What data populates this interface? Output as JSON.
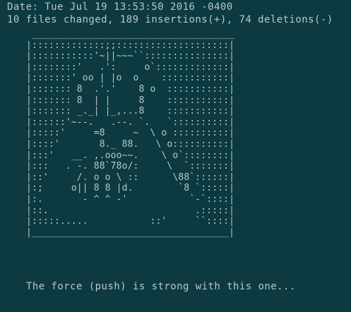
{
  "terminal": {
    "date_line": "Date: Tue Jul 19 13:53:50 2016 -0400",
    "stats_line": "10 files changed, 189 insertions(+), 74 deletions(-)",
    "ascii_art": " ____________________________________\n|:::::::::::::;;::::::::::::::::::::|\n|:::::::::::'~||~~~``:::::::::::::::|\n|::::::::'   .':     o`:::::::::::::|\n|:::::::' oo | |o  o    ::::::::::::|\n|::::::: 8  .'.'    8 o  :::::::::::|\n|::::::: 8  | |     8    :::::::::::|\n|::::::: _._| |_,...8    :::::::::::|\n|::::::'~--.   .--. `.   `::::::::::|\n|:::::'     =8     ~  \\ o ::::::::::|\n|::::'       8._ 88.   \\ o::::::::::|\n|:::'   __. ,.ooo~~.    \\ o`::::::::|\n|:::   . -. 88`78o/:     \\  `:::::::|\n|::'     /. o o \\ ::      \\88`::::::|\n|:;     o|| 8 8 |d.        `8 `:::::|\n|:.       - ^ ^ -'           `-`::::|\n|::.                          .:::::|\n|:::::.....           ::'     ``::::|\n|___________________________________|",
    "message": "The force (push) is strong with this one..."
  },
  "colors": {
    "background": "#0c3a40",
    "foreground": "#b8c8c8"
  }
}
